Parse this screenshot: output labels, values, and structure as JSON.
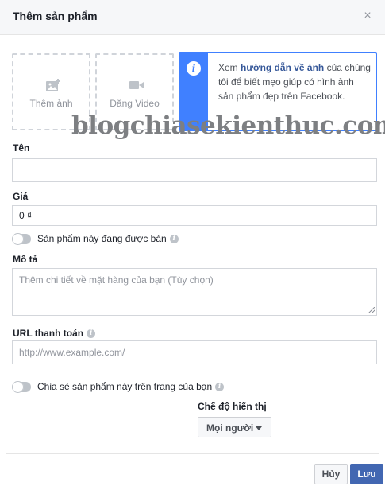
{
  "dialog": {
    "title": "Thêm sản phẩm",
    "close_symbol": "×"
  },
  "media": {
    "add_photo_label": "Thêm ảnh",
    "add_video_label": "Đăng Video",
    "add_photo_icon": "photo-add-icon",
    "add_video_icon": "video-camera-icon"
  },
  "info": {
    "icon_text": "i",
    "text_before": "Xem ",
    "link_text": "hướng dẫn về ảnh",
    "text_after": " của chúng tôi để biết mẹo giúp có hình ảnh sản phẩm đẹp trên Facebook."
  },
  "watermark": "blogchiasekienthuc.com",
  "form": {
    "name_label": "Tên",
    "name_value": "",
    "price_label": "Giá",
    "price_value": "0 ₫",
    "for_sale_label": "Sản phẩm này đang được bán",
    "description_label": "Mô tả",
    "description_placeholder": "Thêm chi tiết về mặt hàng của bạn (Tùy chọn)",
    "checkout_url_label": "URL thanh toán",
    "checkout_url_placeholder": "http://www.example.com/",
    "share_label": "Chia sẻ sản phẩm này trên trang của bạn",
    "visibility_label": "Chế độ hiển thị",
    "visibility_value": "Mọi người"
  },
  "footer": {
    "cancel_label": "Hủy",
    "save_label": "Lưu"
  },
  "colors": {
    "accent": "#4080ff",
    "primary_button": "#4267b2",
    "link": "#365899"
  }
}
